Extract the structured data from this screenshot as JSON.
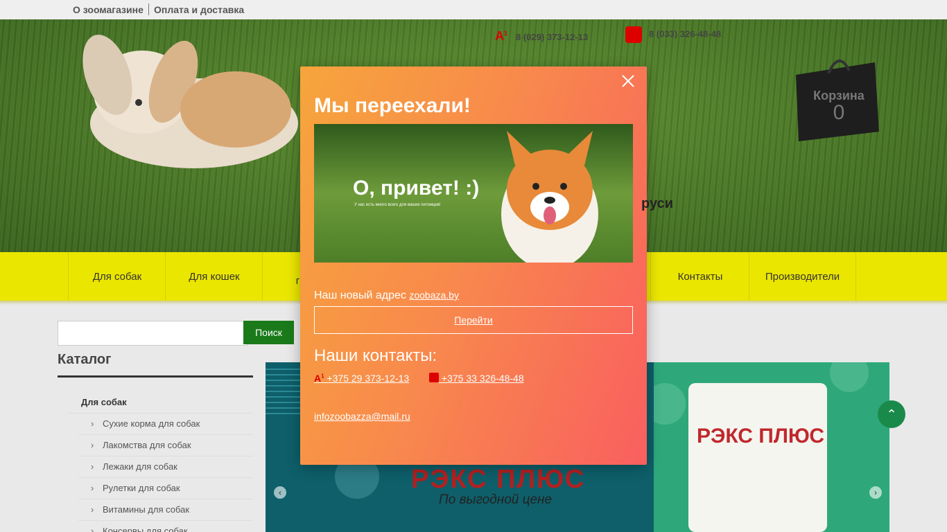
{
  "topbar": {
    "links": [
      "О зоомагазине",
      "Оплата и доставка"
    ]
  },
  "header": {
    "phones": [
      {
        "operator": "A1",
        "number": "8 (029) 373-12-13"
      },
      {
        "operator": "MTS",
        "number": "8 (033) 326-48-48"
      }
    ],
    "cart": {
      "label": "Корзина",
      "count": "0"
    },
    "tagline_tail": "руси"
  },
  "nav": {
    "items": [
      "Для собак",
      "Для кошек",
      "гры",
      "Контакты",
      "Производители"
    ]
  },
  "search": {
    "placeholder": "",
    "button": "Поиск"
  },
  "catalog": {
    "title": "Каталог",
    "head": "Для собак",
    "items": [
      "Сухие корма для собак",
      "Лакомства для собак",
      "Лежаки для собак",
      "Рулетки для собак",
      "Витамины для собак",
      "Консервы для собак"
    ]
  },
  "banner": {
    "big": "РЭКС ПЛЮС",
    "sub": "По выгодной цене",
    "pack_brand": "РЭКС ПЛЮС"
  },
  "modal": {
    "title": "Мы переехали!",
    "photo_text": "О, привет! :)",
    "photo_small": "У нас есть много всего для ваших питомцев!",
    "address_label": "Наш новый адрес",
    "address_link": "zoobaza.by",
    "go_label": "Перейти",
    "contacts_title": "Наши контакты:",
    "phones": [
      "+375 29 373-12-13",
      "+375 33 326-48-48"
    ],
    "email": "infozoobazza@mail.ru"
  },
  "colors": {
    "nav": "#ebe600",
    "modal_from": "#f6a53c",
    "modal_to": "#f95f5f",
    "search_btn": "#1a7a1a"
  }
}
